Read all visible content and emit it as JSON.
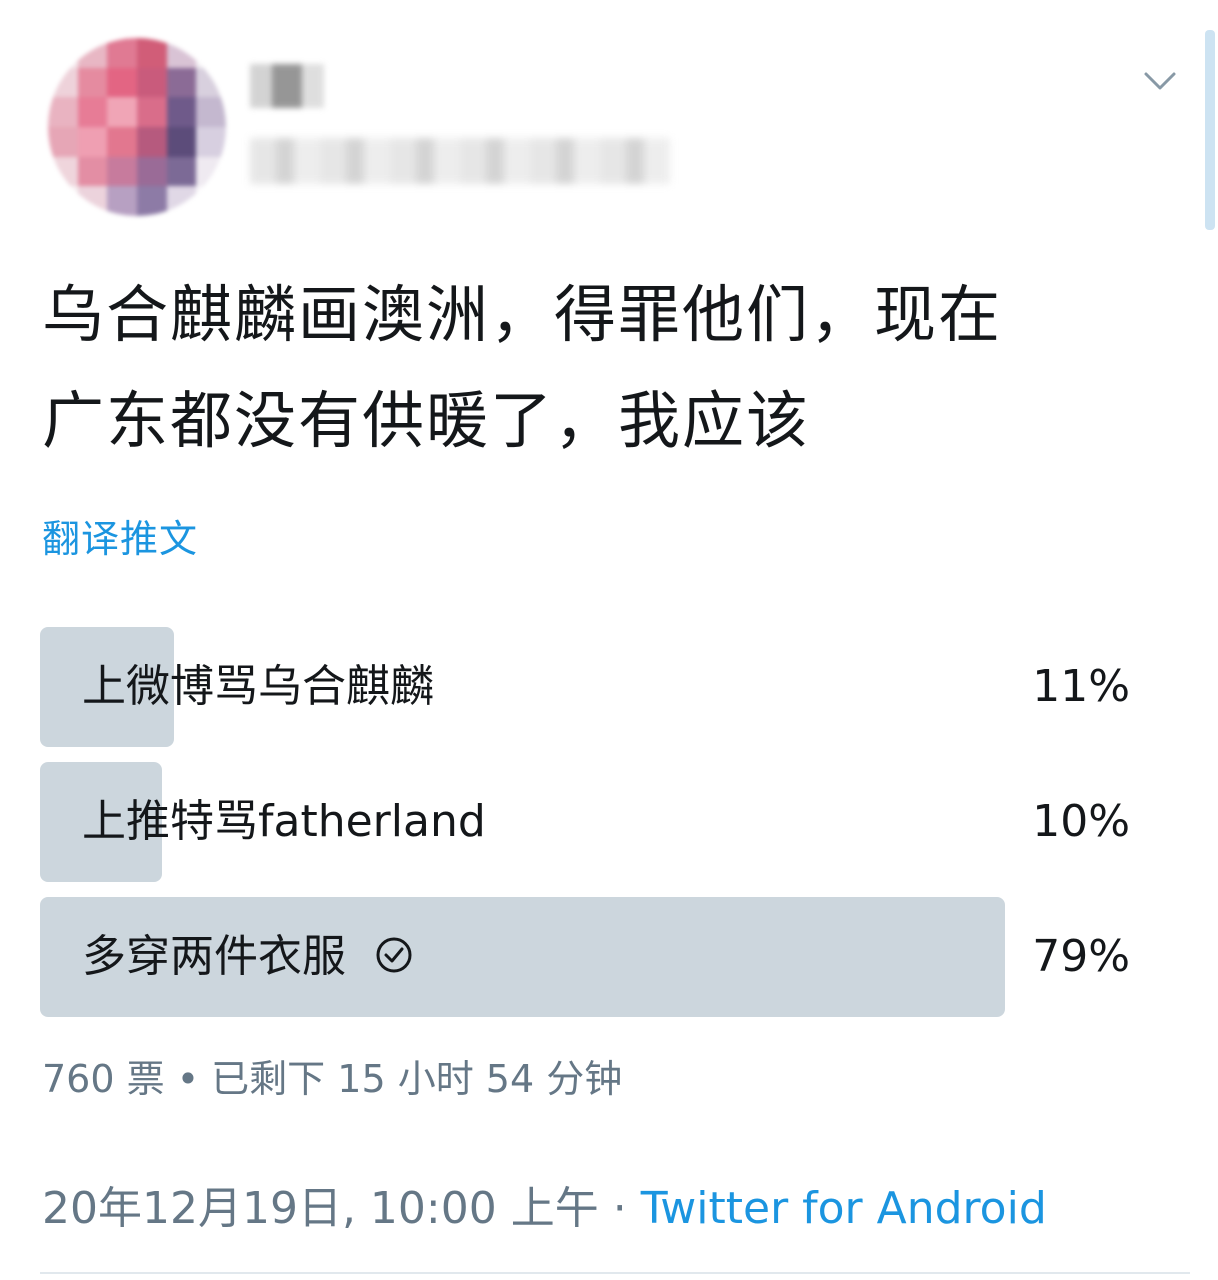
{
  "tweet": {
    "text_line1": "乌合麒麟画澳洲，得罪他们，现在",
    "text_line2": "广东都没有供暖了，我应该",
    "translate_label": "翻译推文"
  },
  "poll": {
    "options": [
      {
        "label": "上微博骂乌合麒麟",
        "percent_label": "11%",
        "percent": 11,
        "winner": false
      },
      {
        "label": "上推特骂fatherland",
        "percent_label": "10%",
        "percent": 10,
        "winner": false
      },
      {
        "label": "多穿两件衣服",
        "percent_label": "79%",
        "percent": 79,
        "winner": true
      }
    ],
    "meta": "760 票 • 已剩下 15 小时 54 分钟"
  },
  "footer": {
    "datetime": "20年12月19日, 10:00 上午 · ",
    "source": "Twitter for Android"
  },
  "icons": {
    "menu": "chevron-down-icon",
    "winner": "check-circle-icon"
  },
  "colors": {
    "accent": "#1b95e0",
    "poll_bar": "#ccd6dd",
    "text": "#14171a",
    "muted": "#657786"
  }
}
